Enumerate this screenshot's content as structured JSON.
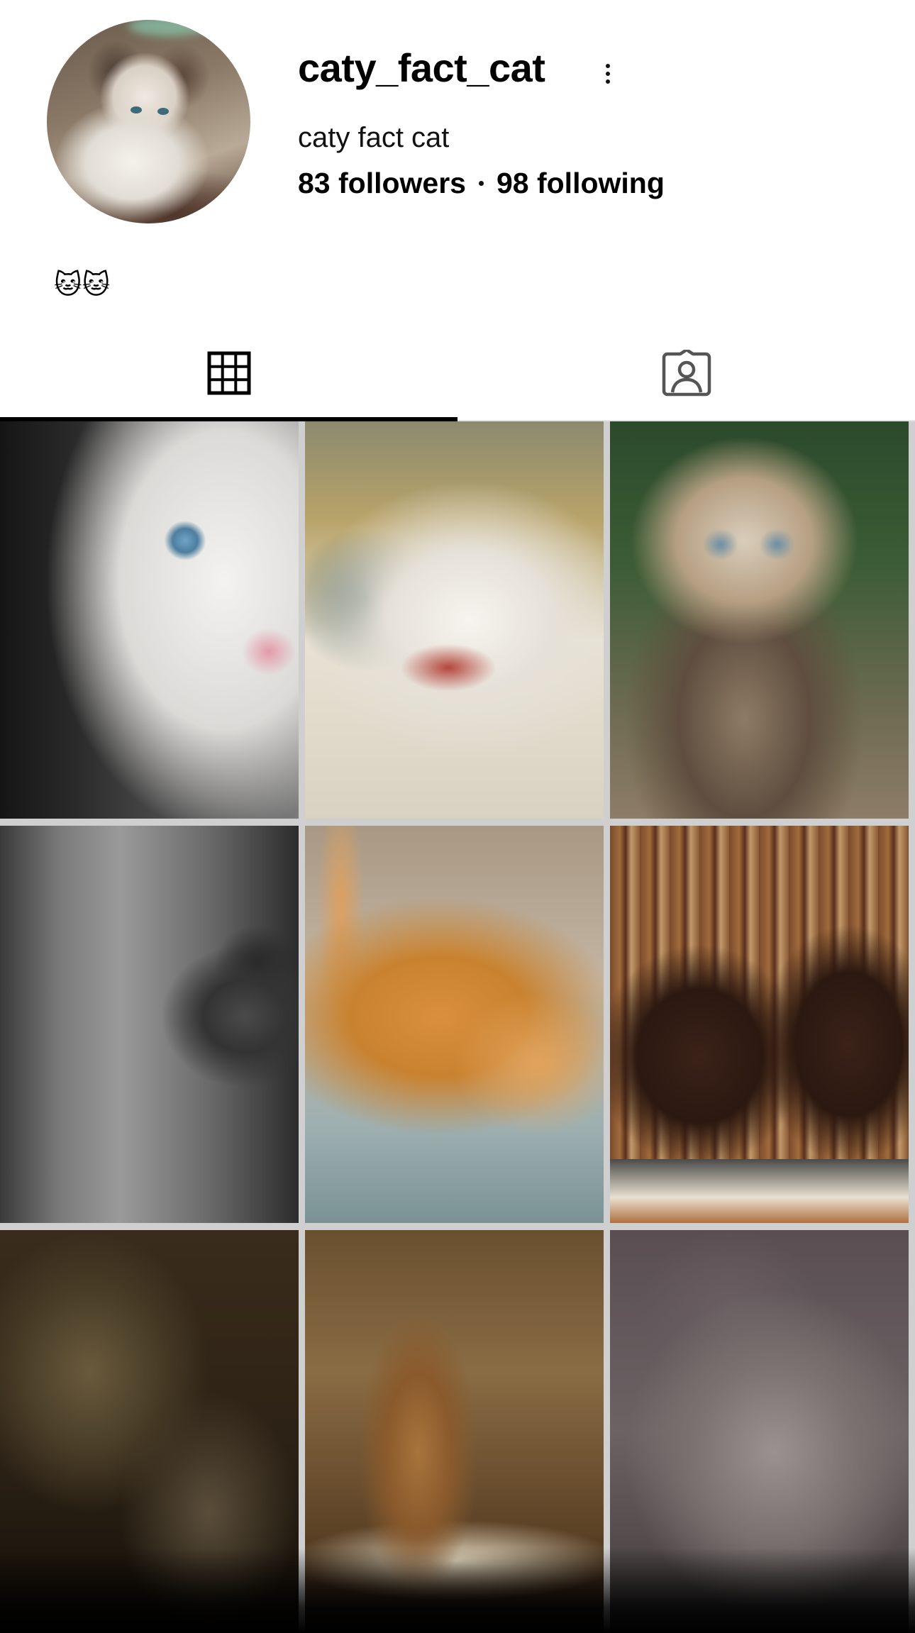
{
  "profile": {
    "username": "caty_fact_cat",
    "display_name": "caty fact cat",
    "followers": "83 followers",
    "following": "98 following",
    "bio": "🐱🐱",
    "avatar_icon": "avatar-image",
    "more_icon": "more-vertical-icon"
  },
  "tabs": [
    {
      "name": "posts-grid",
      "icon": "grid-icon",
      "active": true
    },
    {
      "name": "tagged",
      "icon": "tagged-user-icon",
      "active": false
    }
  ],
  "grid": {
    "columns": 3,
    "posts": [
      {
        "name": "post-1",
        "subject": "white cat blue eye closeup"
      },
      {
        "name": "post-2",
        "subject": "calico cat yawning"
      },
      {
        "name": "post-3",
        "subject": "tabby kitten praying"
      },
      {
        "name": "post-4",
        "subject": "gray cat by window"
      },
      {
        "name": "post-5",
        "subject": "orange kitten crouching"
      },
      {
        "name": "post-6",
        "subject": "brown cats by bookshelf"
      },
      {
        "name": "post-7",
        "subject": "sleeping cats"
      },
      {
        "name": "post-8",
        "subject": "abyssinian kitten sitting"
      },
      {
        "name": "post-9",
        "subject": "fluffy cat upside down"
      }
    ]
  },
  "colors": {
    "background": "#ffffff",
    "text": "#000000",
    "tab_indicator": "#000000",
    "divider": "#e4e4e4"
  }
}
